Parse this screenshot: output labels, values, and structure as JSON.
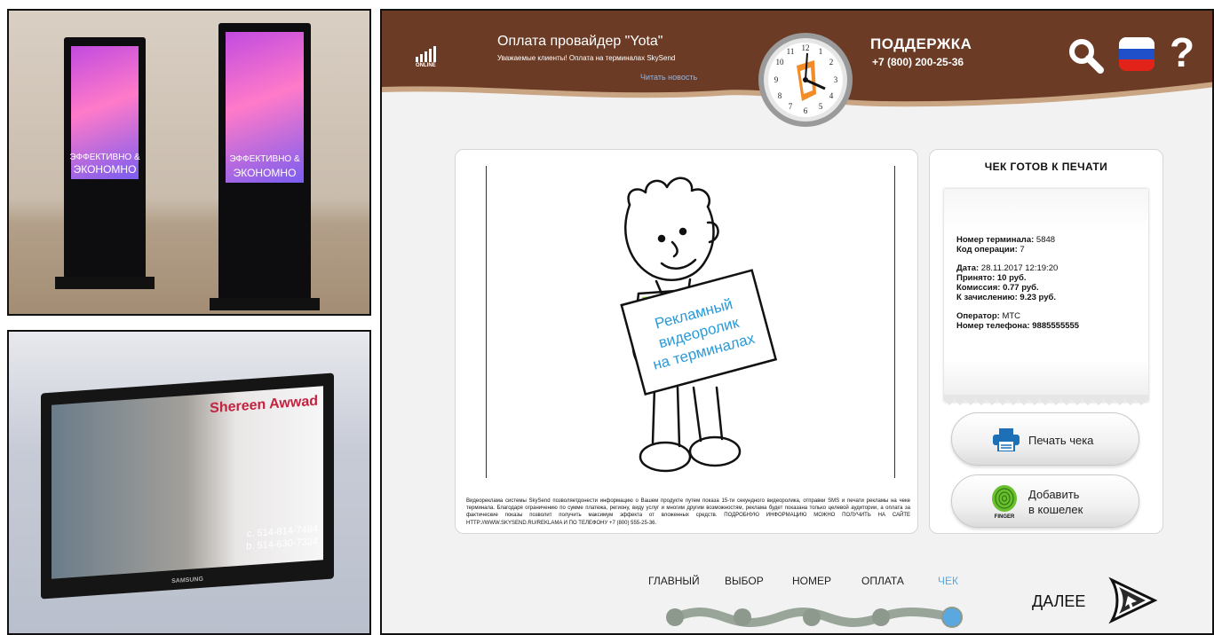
{
  "left_photos": {
    "kiosk_text_line1": "ЭФФЕКТИВНО &",
    "kiosk_text_line2": "ЭКОНОМНО",
    "tv_name": "Shereen Awwad",
    "tv_phone1": "c. 514-814-7464",
    "tv_phone2": "b. 514-630-7324",
    "tv_brand": "SAMSUNG"
  },
  "header": {
    "signal_label": "ONLINE",
    "title": "Оплата провайдер \"Yota\"",
    "subtitle": "Уважаемые клиенты!   Оплата на терминалах SkySend",
    "read_news": "Читать новость",
    "support_title": "ПОДДЕРЖКА",
    "support_phone": "+7 (800) 200-25-36",
    "flag_colors": [
      "#ffffff",
      "#1f4fc9",
      "#e2231a"
    ]
  },
  "ad": {
    "sign_line1": "Рекламный",
    "sign_line2": "видеоролик",
    "sign_line3": "на терминалах",
    "description": "Видеореклама системы SkySend позволяетдонести информацию о Вашем продукте путем показа 15-ти секундного видеоролика, отправки SMS и печати рекламы на чеке терминала. Благодаря ограничению по сумме платежа, региону, виду услуг и многим другим возможностям, реклама будет показана только целевой аудитории, а оплата за фактические показы позволит получить максимум эффекта от вложенных средств. ПОДРОБНУЮ ИНФОРМАЦИЮ МОЖНО ПОЛУЧИТЬ НА САЙТЕ HTTP://WWW.SKYSEND.RU/REKLAMA И ПО ТЕЛЕФОНУ +7 (800) 555-25-36."
  },
  "receipt": {
    "title": "ЧЕК ГОТОВ К ПЕЧАТИ",
    "terminal_label": "Номер терминала:",
    "terminal_value": "5848",
    "opcode_label": "Код операции:",
    "opcode_value": "7",
    "date_label": "Дата:",
    "date_value": "28.11.2017 12:19:20",
    "accepted": "Принято: 10 руб.",
    "commission": "Комиссия: 0.77 руб.",
    "credited": "К зачислению: 9.23 руб.",
    "operator_label": "Оператор:",
    "operator_value": "МТС",
    "phone_label": "Номер телефона:",
    "phone_value": "9885555555",
    "print_button": "Печать чека",
    "wallet_button_line1": "Добавить",
    "wallet_button_line2": "в кошелек",
    "finger_label": "FINGER"
  },
  "steps": {
    "items": [
      "ГЛАВНЫЙ",
      "ВЫБОР",
      "НОМЕР",
      "ОПЛАТА",
      "ЧЕК"
    ],
    "active": "ЧЕК",
    "accent": "#5aa8e0",
    "next_label": "ДАЛЕЕ"
  },
  "colors": {
    "header_brown": "#6b3b25",
    "header_border": "#c9a583"
  }
}
